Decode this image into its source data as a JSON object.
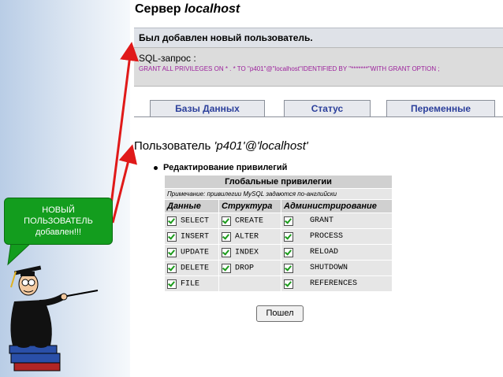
{
  "server": {
    "prefix": "Сервер",
    "host": "localhost"
  },
  "notice": "Был добавлен новый пользователь.",
  "sql": {
    "label": "SQL-запрос :",
    "query": "GRANT ALL PRIVILEGES ON * . * TO \"p401\"@\"localhost\"IDENTIFIED BY \"*******\"WITH GRANT OPTION ;"
  },
  "tabs": [
    "Базы Данных",
    "Статус",
    "Переменные"
  ],
  "user": {
    "prefix": "Пользователь",
    "name": "'p401'@'localhost'"
  },
  "edit_heading": "Редактирование привилегий",
  "privileges": {
    "title": "Глобальные привилегии",
    "note": "Примечание: привилегии MySQL задаются по-английски",
    "groups": [
      "Данные",
      "Структура",
      "Администрирование"
    ],
    "data": [
      "SELECT",
      "INSERT",
      "UPDATE",
      "DELETE",
      "FILE"
    ],
    "structure": [
      "CREATE",
      "ALTER",
      "INDEX",
      "DROP"
    ],
    "admin": [
      "GRANT",
      "PROCESS",
      "RELOAD",
      "SHUTDOWN",
      "REFERENCES"
    ]
  },
  "go_button": "Пошел",
  "bubble": [
    "НОВЫЙ",
    "ПОЛЬЗОВАТЕЛЬ",
    "добавлен!!!"
  ],
  "colors": {
    "bubble": "#139d1e",
    "arrow": "#e01919",
    "tab_text": "#2b3f9b",
    "sql_text": "#9b1f9b"
  }
}
